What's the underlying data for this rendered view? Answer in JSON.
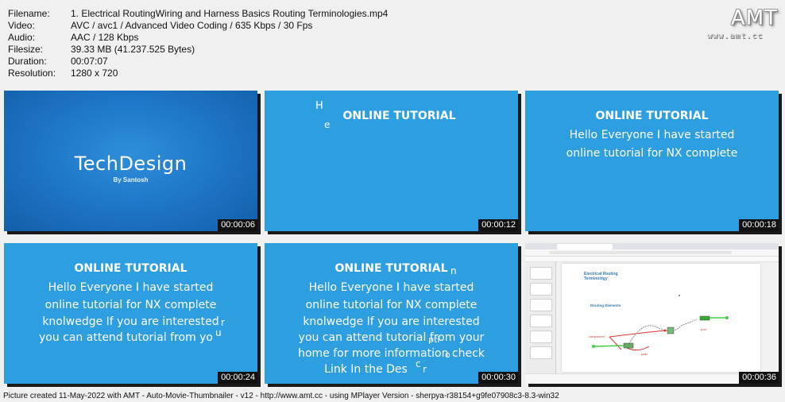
{
  "info": [
    {
      "key": "Filename:",
      "value": "1. Electrical RoutingWiring and Harness  Basics  Routing Terminologies.mp4"
    },
    {
      "key": "Video:",
      "value": "AVC / avc1 / Advanced Video Coding / 635 Kbps / 30 Fps"
    },
    {
      "key": "Audio:",
      "value": "AAC / 128 Kbps"
    },
    {
      "key": "Filesize:",
      "value": "39.33 MB (41.237.525 Bytes)"
    },
    {
      "key": "Duration:",
      "value": "00:07:07"
    },
    {
      "key": "Resolution:",
      "value": "1280 x 720"
    }
  ],
  "logo": {
    "text": "AMT",
    "url": "www.amt.cc"
  },
  "thumbs": [
    {
      "time": "00:00:06",
      "brand": "TechDesign",
      "byline": "By Santosh"
    },
    {
      "time": "00:00:12",
      "heading": "ONLINE TUTORIAL",
      "stray": [
        "H",
        "e"
      ]
    },
    {
      "time": "00:00:18",
      "heading": "ONLINE TUTORIAL",
      "lines": [
        "Hello Everyone I have started",
        "online tutorial for NX complete"
      ]
    },
    {
      "time": "00:00:24",
      "heading": "ONLINE TUTORIAL",
      "lines": [
        "Hello Everyone I have started",
        "online tutorial for NX complete",
        "knolwedge If you are interested",
        "you can attend tutorial from yo"
      ],
      "stray": [
        "r",
        "u"
      ]
    },
    {
      "time": "00:00:30",
      "heading": "ONLINE TUTORIAL",
      "lines": [
        "Hello Everyone I have started",
        "online tutorial for NX complete",
        "knolwedge If you are interested",
        "you can attend tutorial from your",
        "home for more information check",
        "Link In the Des"
      ],
      "stray": [
        "n",
        "c",
        "r",
        "pti",
        "o"
      ]
    },
    {
      "time": "00:00:36",
      "title": "Electrical Routing Terminology",
      "subtitle": "Routing Elements",
      "labels": [
        "component",
        "path",
        "port"
      ]
    }
  ],
  "footer": "Picture created 11-May-2022 with AMT - Auto-Movie-Thumbnailer - v12 - http://www.amt.cc - using MPlayer Version - sherpya-r38154+g9fe07908c3-8.3-win32",
  "colors": {
    "slide_blue": "#2d9ee0",
    "intro_blue": "#1f78c9",
    "timestamp_bg": "#111111"
  }
}
